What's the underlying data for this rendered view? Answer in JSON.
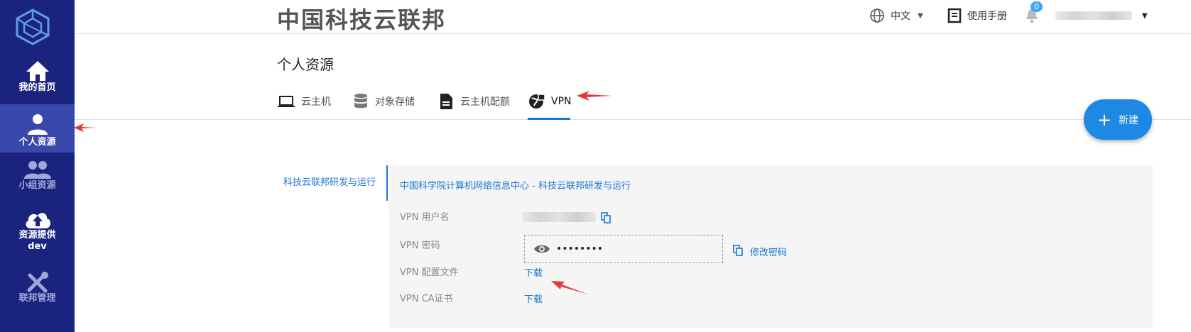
{
  "sidebar": {
    "items": [
      {
        "label": "我的首页",
        "icon": "home-icon"
      },
      {
        "label": "个人资源",
        "icon": "person-icon"
      },
      {
        "label": "小组资源",
        "icon": "group-icon"
      },
      {
        "label": "资源提供",
        "sublabel": "dev",
        "icon": "cloud-upload-icon"
      },
      {
        "label": "联邦管理",
        "icon": "tools-icon"
      }
    ],
    "active_index": 1
  },
  "header": {
    "brand": "中国科技云联邦",
    "language": "中文",
    "manual": "使用手册",
    "notification_count": "0"
  },
  "page": {
    "title": "个人资源",
    "tabs": [
      {
        "label": "云主机",
        "icon": "laptop-icon"
      },
      {
        "label": "对象存储",
        "icon": "database-icon"
      },
      {
        "label": "云主机配额",
        "icon": "document-icon"
      },
      {
        "label": "VPN",
        "icon": "vpn-globe-icon"
      }
    ],
    "active_tab": 3,
    "new_button": "新建"
  },
  "vpn": {
    "side_tab": "科技云联邦研发与运行",
    "panel_title": "中国科学院计算机网络信息中心 - 科技云联邦研发与运行",
    "username_label": "VPN 用户名",
    "password_label": "VPN 密码",
    "password_masked": "••••••••",
    "change_password": "修改密码",
    "config_label": "VPN 配置文件",
    "config_download": "下载",
    "ca_label": "VPN CA证书",
    "ca_download": "下载"
  },
  "colors": {
    "sidebar_bg": "#1a237e",
    "sidebar_active": "#3949ab",
    "accent": "#1976d2",
    "fab": "#1e88e5",
    "annotation_arrow": "#e53935"
  }
}
